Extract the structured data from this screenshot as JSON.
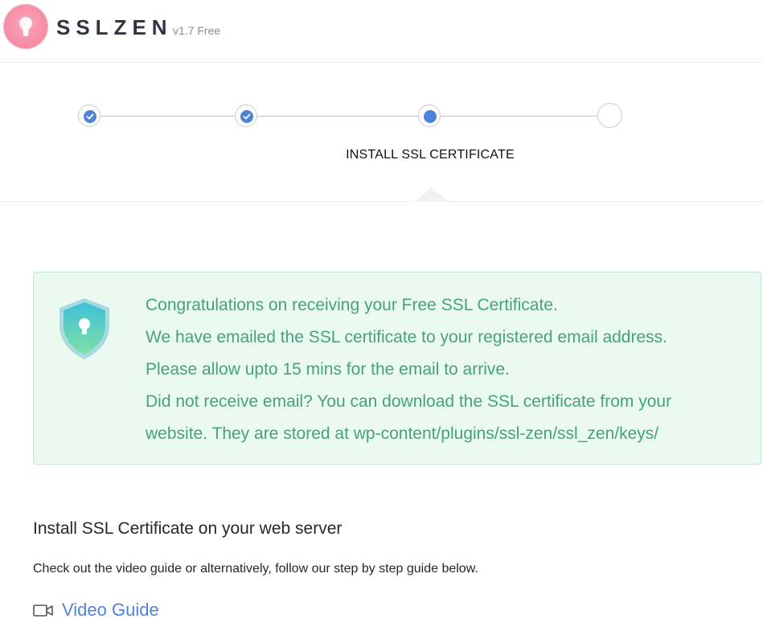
{
  "header": {
    "brand": "SSLZEN",
    "version": "v1.7 Free"
  },
  "stepper": {
    "active_label": "INSTALL SSL CERTIFICATE",
    "steps": [
      {
        "state": "completed"
      },
      {
        "state": "completed"
      },
      {
        "state": "active"
      },
      {
        "state": "pending"
      }
    ],
    "accent_color": "#4f83d9"
  },
  "notice": {
    "lines": [
      "Congratulations on receiving your Free SSL Certificate.",
      "We have emailed the SSL certificate to your registered email address.",
      "Please allow upto 15 mins for the email to arrive.",
      "Did not receive email? You can download the SSL certificate from your",
      "website. They are stored at wp-content/plugins/ssl-zen/ssl_zen/keys/"
    ],
    "icon": "shield-lock-icon",
    "text_color": "#45a27a",
    "background": "#eafaf1"
  },
  "install": {
    "title": "Install SSL Certificate on your web server",
    "description": "Check out the video guide or alternatively, follow our step by step guide below.",
    "video_link_label": "Video Guide",
    "video_icon": "video-camera-icon"
  }
}
